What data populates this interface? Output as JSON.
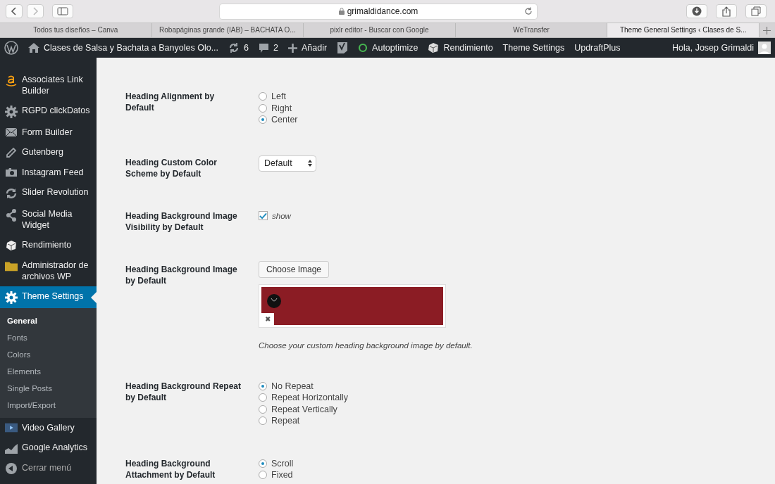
{
  "browser": {
    "url": "grimaldidance.com",
    "tabs": [
      {
        "title": "Todos tus diseños – Canva",
        "selected": false
      },
      {
        "title": "Robapáginas grande (IAB) – BACHATA O...",
        "selected": false
      },
      {
        "title": "pixlr editor - Buscar con Google",
        "selected": false
      },
      {
        "title": "WeTransfer",
        "selected": false
      },
      {
        "title": "Theme General Settings ‹ Clases de S...",
        "selected": true
      }
    ]
  },
  "admin_bar": {
    "site_title": "Clases de Salsa y Bachata a Banyoles Olo...",
    "updates": "6",
    "comments": "2",
    "new_label": "Añadir",
    "items": [
      "Autoptimize",
      "Rendimiento",
      "Theme Settings",
      "UpdraftPlus"
    ],
    "greeting": "Hola, Josep Grimaldi"
  },
  "sidebar": {
    "items": [
      {
        "label": "Associates Link Builder",
        "selected": false
      },
      {
        "label": "RGPD clickDatos",
        "selected": false
      },
      {
        "label": "Form Builder",
        "selected": false
      },
      {
        "label": "Gutenberg",
        "selected": false
      },
      {
        "label": "Instagram Feed",
        "selected": false
      },
      {
        "label": "Slider Revolution",
        "selected": false
      },
      {
        "label": "Social Media Widget",
        "selected": false
      },
      {
        "label": "Rendimiento",
        "selected": false
      },
      {
        "label": "Administrador de archivos WP",
        "selected": false
      },
      {
        "label": "Theme Settings",
        "selected": true,
        "submenu": [
          {
            "label": "General",
            "selected": true
          },
          {
            "label": "Fonts",
            "selected": false
          },
          {
            "label": "Colors",
            "selected": false
          },
          {
            "label": "Elements",
            "selected": false
          },
          {
            "label": "Single Posts",
            "selected": false
          },
          {
            "label": "Import/Export",
            "selected": false
          }
        ]
      },
      {
        "label": "Video Gallery",
        "selected": false
      },
      {
        "label": "Google Analytics",
        "selected": false
      }
    ],
    "collapse_label": "Cerrar menú"
  },
  "settings": [
    {
      "kind": "radio",
      "label": "Heading Alignment by Default",
      "options": [
        {
          "label": "Left",
          "selected": false
        },
        {
          "label": "Right",
          "selected": false
        },
        {
          "label": "Center",
          "selected": true
        }
      ]
    },
    {
      "kind": "select",
      "label": "Heading Custom Color Scheme by Default",
      "value": "Default"
    },
    {
      "kind": "checkbox",
      "label": "Heading Background Image Visibility by Default",
      "checked": true,
      "option": "show"
    },
    {
      "label": "Heading Background Image by Default",
      "button": "Choose Image",
      "remove": "✖",
      "description": "Choose your custom heading background image by default."
    },
    {
      "kind": "radio",
      "label": "Heading Background Repeat by Default",
      "options": [
        {
          "label": "No Repeat",
          "selected": true
        },
        {
          "label": "Repeat Horizontally",
          "selected": false
        },
        {
          "label": "Repeat Vertically",
          "selected": false
        },
        {
          "label": "Repeat",
          "selected": false
        }
      ]
    },
    {
      "kind": "radio",
      "label": "Heading Background Attachment by Default",
      "options": [
        {
          "label": "Scroll",
          "selected": true
        },
        {
          "label": "Fixed",
          "selected": false
        }
      ]
    }
  ]
}
